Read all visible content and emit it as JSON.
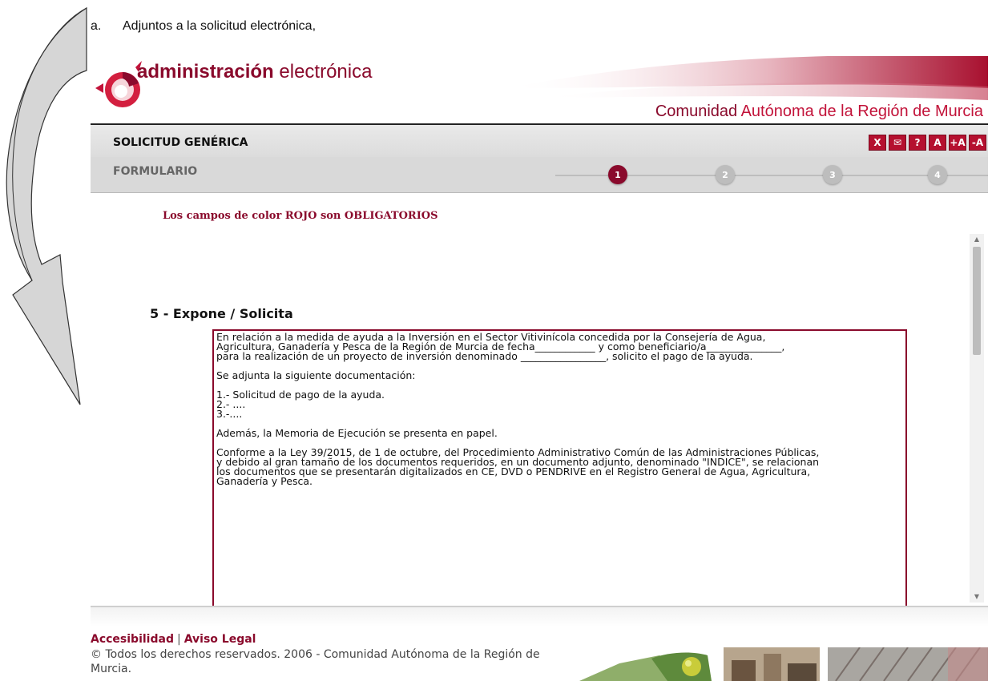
{
  "document": {
    "list_marker": "a.",
    "caption": "Adjuntos a la solicitud electrónica,"
  },
  "header": {
    "logo_bold": "administración",
    "logo_light": "electrónica",
    "region_part1": "Comunidad",
    "region_part2": "Autónoma de la Región de Murcia"
  },
  "titlebar": {
    "title": "SOLICITUD GENÉRICA",
    "tools": [
      "X",
      "✉",
      "?",
      "A",
      "+A",
      "-A"
    ]
  },
  "stepbar": {
    "subtitle": "FORMULARIO",
    "steps": [
      "1",
      "2",
      "3",
      "4"
    ],
    "active_step": 1
  },
  "form": {
    "required_note": "Los campos de color ROJO son OBLIGATORIOS",
    "section_title": "5 - Expone / Solicita",
    "textarea_value": "En relación a la medida de ayuda a la Inversión en el Sector Vitivinícola concedida por la Consejería de Agua,\nAgricultura, Ganadería y Pesca de la Región de Murcia de fecha____________ y como beneficiario/a_______________,\npara la realización de un proyecto de inversión denominado _________________, solicito el pago de la ayuda.\n\nSe adjunta la siguiente documentación:\n\n1.- Solicitud de pago de la ayuda.\n2.- ....\n3.-....\n\nAdemás, la Memoria de Ejecución se presenta en papel.\n\nConforme a la Ley 39/2015, de 1 de octubre, del Procedimiento Administrativo Común de las Administraciones Públicas,\ny debido al gran tamaño de los documentos requeridos, en un documento adjunto, denominado \"INDICE\", se relacionan\nlos documentos que se presentarán digitalizados en CE, DVD o PENDRIVE en el Registro General de Agua, Agricultura,\nGanadería y Pesca."
  },
  "footer": {
    "accessibility": "Accesibilidad",
    "separator": "|",
    "legal": "Aviso Legal",
    "copyright": "© Todos los derechos reservados. 2006 - Comunidad Autónoma de la Región de Murcia."
  },
  "colors": {
    "brand": "#8a0a2c",
    "tool_button": "#b5102f",
    "step_inactive": "#bdbdbd"
  },
  "icons": {
    "logo": "circular-emblem-icon",
    "left_arrow": "curved-arrow-icon"
  }
}
